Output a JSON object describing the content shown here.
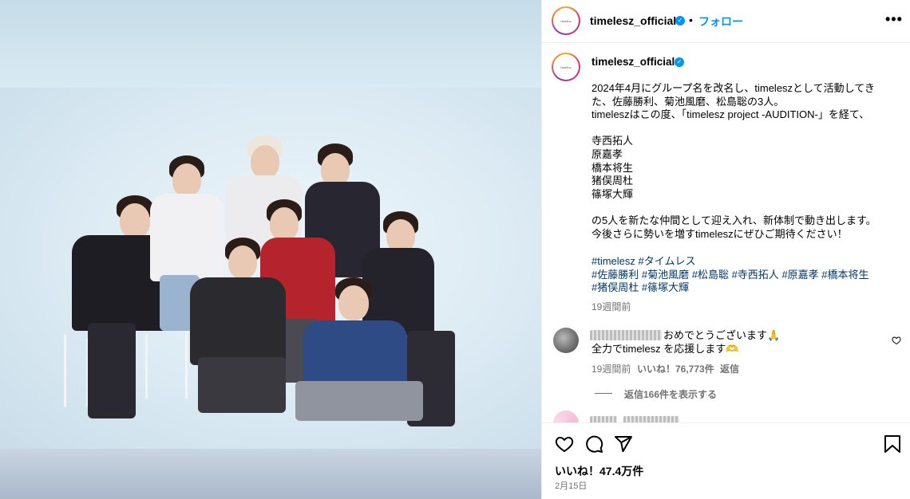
{
  "post": {
    "username": "timelesz_official",
    "follow_label": "フォロー",
    "separator": "•",
    "avatar_text": "timelesz"
  },
  "caption": {
    "username": "timelesz_official",
    "text": "2024年4月にグループ名を改名し、timeleszとして活動してきた、佐藤勝利、菊池風磨、松島聡の3人。\ntimeleszはこの度、「timelesz project -AUDITION-」を経て、\n\n寺西拓人\n原嘉孝\n橋本将生\n猪俣周杜\n篠塚大輝\n\nの5人を新たな仲間として迎え入れ、新体制で動き出します。\n今後さらに勢いを増すtimeleszにぜひご期待ください！",
    "hashtags": [
      "#timelesz",
      "#タイムレス",
      "#佐藤勝利",
      "#菊池風磨",
      "#松島聡",
      "#寺西拓人",
      "#原嘉孝",
      "#橋本将生",
      "#猪俣周杜",
      "#篠塚大輝"
    ],
    "time": "19週間前"
  },
  "comment": {
    "text_line1": "おめでとうございます🙏",
    "text_line2": "全力でtimelesz を応援します🫶",
    "time": "19週間前",
    "likes": "いいね！76,773件",
    "reply": "返信",
    "view_replies": "返信166件を表示する"
  },
  "footer": {
    "likes": "いいね！47.4万件",
    "date": "2月15日"
  },
  "colors": {
    "link": "#0095f6",
    "hashtag": "#00376b",
    "muted": "#737373"
  },
  "icons": [
    "more-icon",
    "verified-icon",
    "heart-icon",
    "comment-icon",
    "share-icon",
    "bookmark-icon"
  ]
}
